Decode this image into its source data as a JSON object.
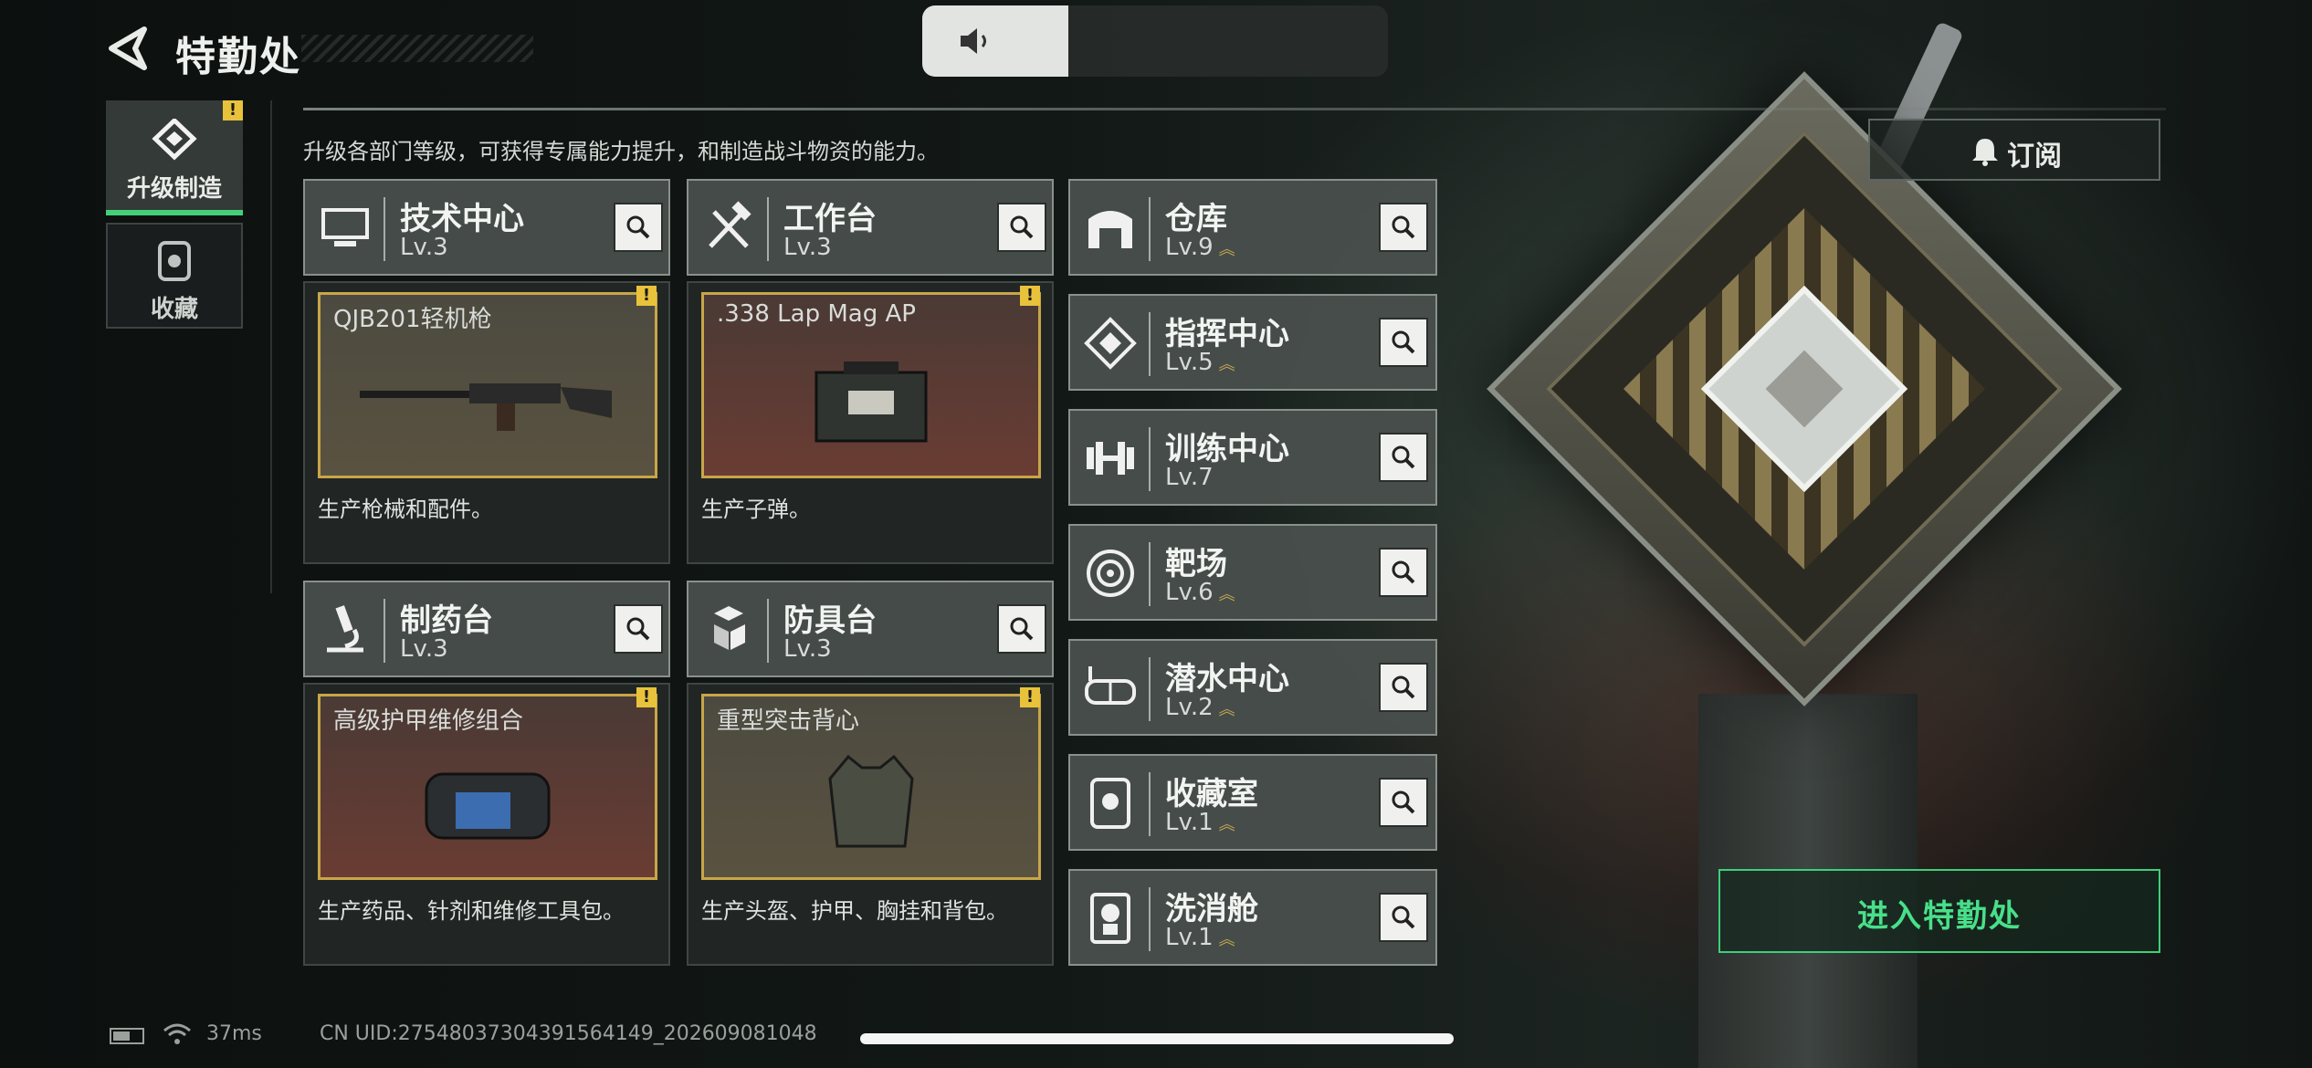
{
  "header": {
    "title": "特勤处"
  },
  "side_nav": [
    {
      "label": "升级制造",
      "icon": "upgrade-craft-icon",
      "active": true,
      "alert": "!"
    },
    {
      "label": "收藏",
      "icon": "collection-icon",
      "active": false
    }
  ],
  "description": "升级各部门等级，可获得专属能力提升，和制造战斗物资的能力。",
  "subscribe_label": "订阅",
  "production_departments": [
    {
      "name": "技术中心",
      "level": "Lv.3",
      "icon": "computer-icon",
      "product": "QJB201轻机枪",
      "product_icon": "machine-gun-icon",
      "alert": "!",
      "desc": "生产枪械和配件。"
    },
    {
      "name": "工作台",
      "level": "Lv.3",
      "icon": "hammer-wrench-icon",
      "product": ".338 Lap Mag AP",
      "product_icon": "ammo-box-icon",
      "alert": "!",
      "desc": "生产子弹。"
    },
    {
      "name": "制药台",
      "level": "Lv.3",
      "icon": "microscope-icon",
      "product": "高级护甲维修组合",
      "product_icon": "repair-kit-icon",
      "alert": "!",
      "desc": "生产药品、针剂和维修工具包。"
    },
    {
      "name": "防具台",
      "level": "Lv.3",
      "icon": "armor-blocks-icon",
      "product": "重型突击背心",
      "product_icon": "vest-icon",
      "alert": "!",
      "desc": "生产头盔、护甲、胸挂和背包。"
    }
  ],
  "facilities": [
    {
      "name": "仓库",
      "level": "Lv.9",
      "icon": "warehouse-icon",
      "upgradable": true
    },
    {
      "name": "指挥中心",
      "level": "Lv.5",
      "icon": "command-icon",
      "upgradable": true
    },
    {
      "name": "训练中心",
      "level": "Lv.7",
      "icon": "dumbbell-icon",
      "upgradable": false
    },
    {
      "name": "靶场",
      "level": "Lv.6",
      "icon": "target-icon",
      "upgradable": true
    },
    {
      "name": "潜水中心",
      "level": "Lv.2",
      "icon": "dive-mask-icon",
      "upgradable": true
    },
    {
      "name": "收藏室",
      "level": "Lv.1",
      "icon": "trophy-case-icon",
      "upgradable": true
    },
    {
      "name": "洗消舱",
      "level": "Lv.1",
      "icon": "decon-icon",
      "upgradable": true
    }
  ],
  "enter_button": "进入特勤处",
  "status": {
    "ping": "37ms",
    "uid": "CN UID:27548037304391564149_202609081048"
  },
  "colors": {
    "accent_green": "#44d07a",
    "alert_yellow": "#e8c23a",
    "product_border": "#c8a648",
    "upgrade_chevron": "#c7a94f"
  }
}
